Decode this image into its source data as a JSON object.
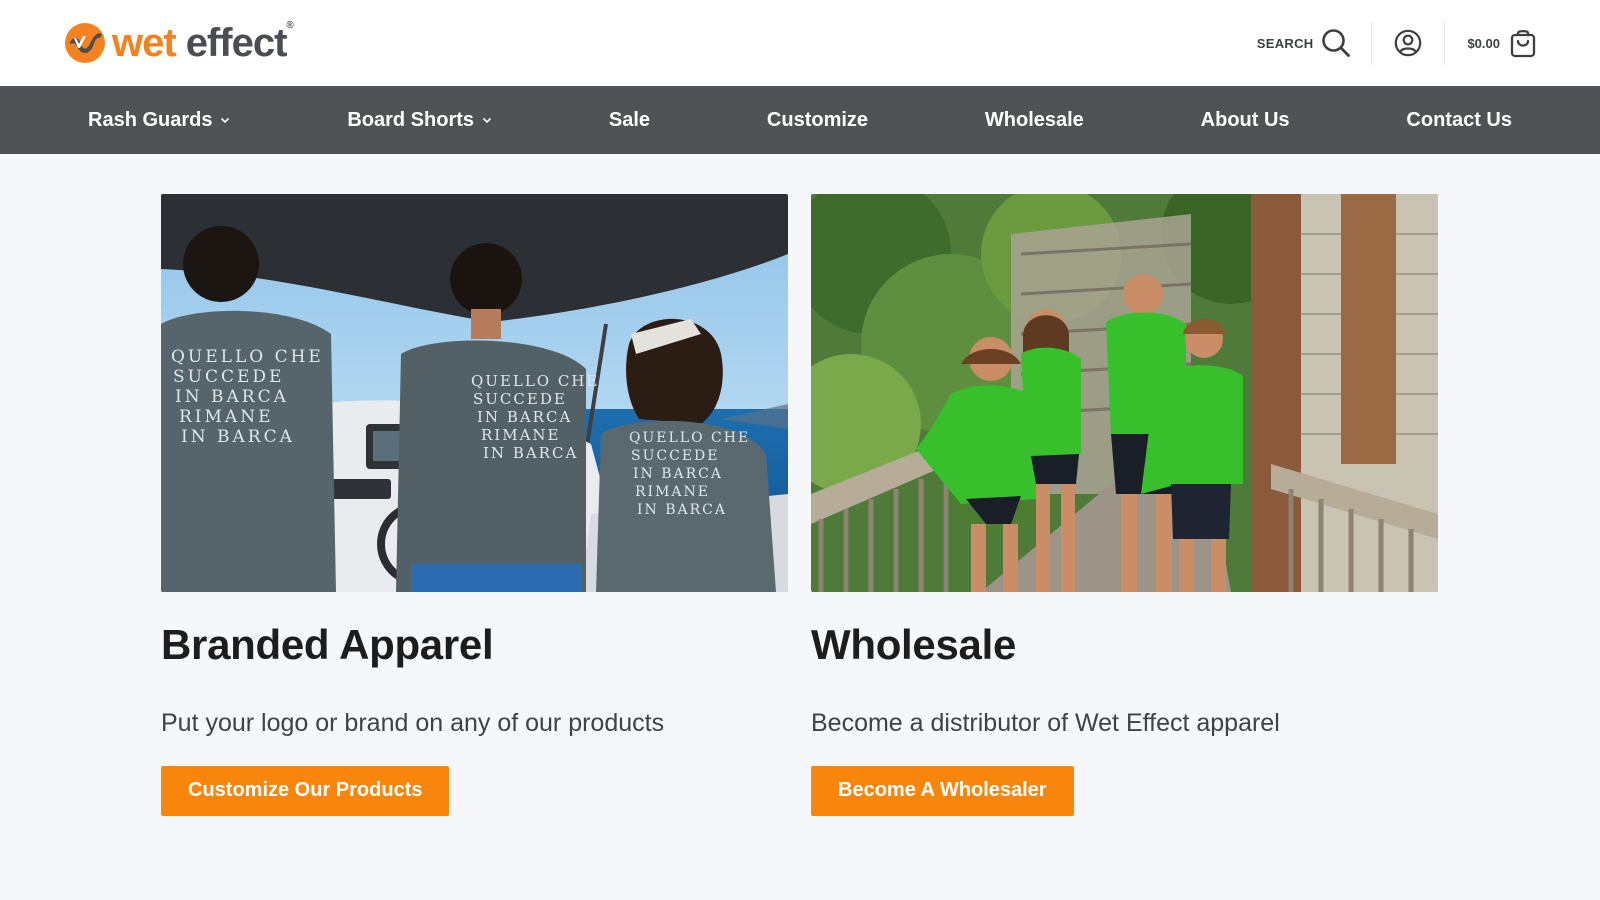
{
  "brand": {
    "name_part1": "wet",
    "name_part2": "effect",
    "registered_mark": "®",
    "colors": {
      "orange": "#f58220",
      "gray": "#4a4d52"
    }
  },
  "header": {
    "search_label": "SEARCH",
    "cart_total": "$0.00",
    "icons": [
      "search-icon",
      "account-icon",
      "cart-icon"
    ]
  },
  "nav": {
    "items": [
      {
        "label": "Rash Guards",
        "has_dropdown": true
      },
      {
        "label": "Board Shorts",
        "has_dropdown": true
      },
      {
        "label": "Sale",
        "has_dropdown": false
      },
      {
        "label": "Customize",
        "has_dropdown": false
      },
      {
        "label": "Wholesale",
        "has_dropdown": false
      },
      {
        "label": "About Us",
        "has_dropdown": false
      },
      {
        "label": "Contact Us",
        "has_dropdown": false
      }
    ]
  },
  "cards": [
    {
      "title": "Branded Apparel",
      "description": "Put your logo or brand on any of our products",
      "button_label": "Customize Our Products",
      "image_shirt_text": [
        "QUELLO CHE",
        "SUCCEDE",
        "IN BARCA",
        "RIMANE",
        "IN BARCA"
      ]
    },
    {
      "title": "Wholesale",
      "description": "Become a distributor of Wet Effect apparel",
      "button_label": "Become A Wholesaler"
    }
  ],
  "colors": {
    "nav_bg": "#505355",
    "button_bg": "#f8860d",
    "page_bg": "#f6f7fa"
  }
}
